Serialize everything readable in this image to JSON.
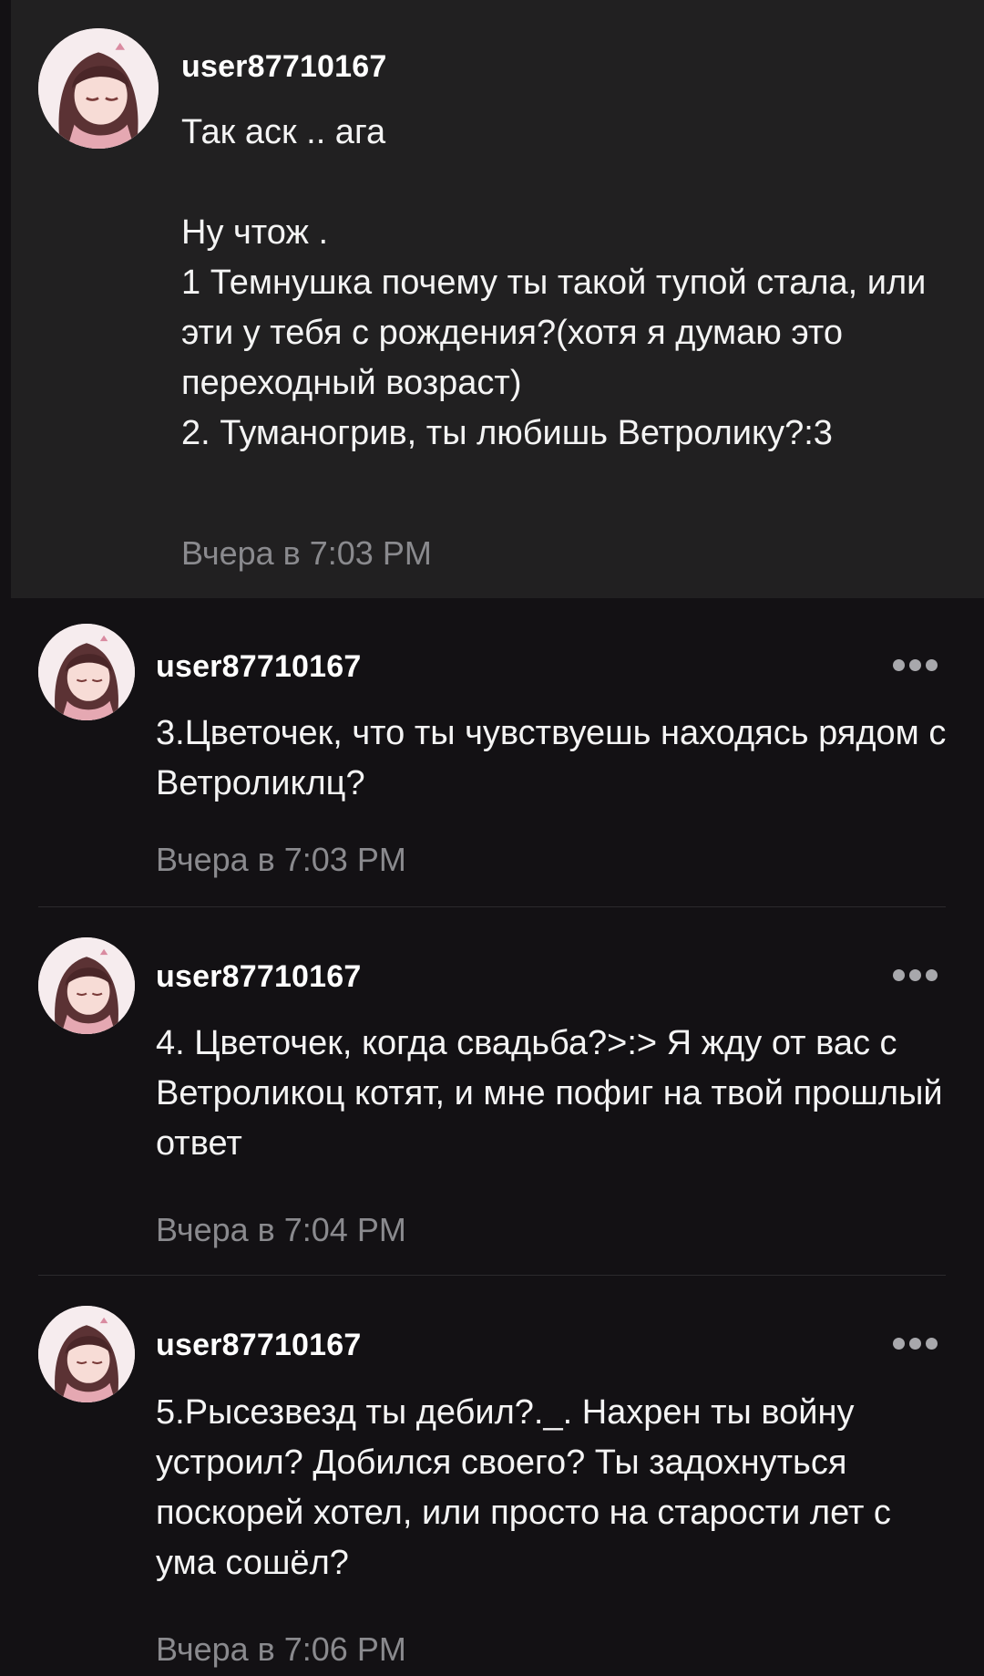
{
  "comments": [
    {
      "username": "user87710167",
      "text": "Так аск .. ага\n\nНу чтож .\n1 Темнушка почему ты такой тупой стала, или эти у тебя с рождения?(хотя я думаю это переходный возраст)\n2. Туманогрив, ты любишь Ветролику?:3",
      "time": "Вчера в 7:03 PM"
    },
    {
      "username": "user87710167",
      "text": "3.Цветочек, что ты чувствуешь находясь рядом с Ветроликлц?",
      "time": "Вчера в 7:03 PM"
    },
    {
      "username": "user87710167",
      "text": "4. Цветочек, когда свадьба?>:> Я жду от вас с Ветроликоц котят, и мне пофиг на твой прошлый ответ",
      "time": "Вчера в 7:04 PM"
    },
    {
      "username": "user87710167",
      "text": "5.Рысезвезд ты дебил?._. Нахрен ты войну устроил? Добился своего? Ты задохнуться поскорей хотел, или просто на старости лет с ума сошёл?",
      "time": "Вчера в 7:06 PM"
    }
  ],
  "icons": {
    "more": "more-horizontal-icon"
  },
  "colors": {
    "background": "#131114",
    "pinned_background": "#212021",
    "timestamp": "#8a8a8e",
    "username": "#ffffff"
  }
}
